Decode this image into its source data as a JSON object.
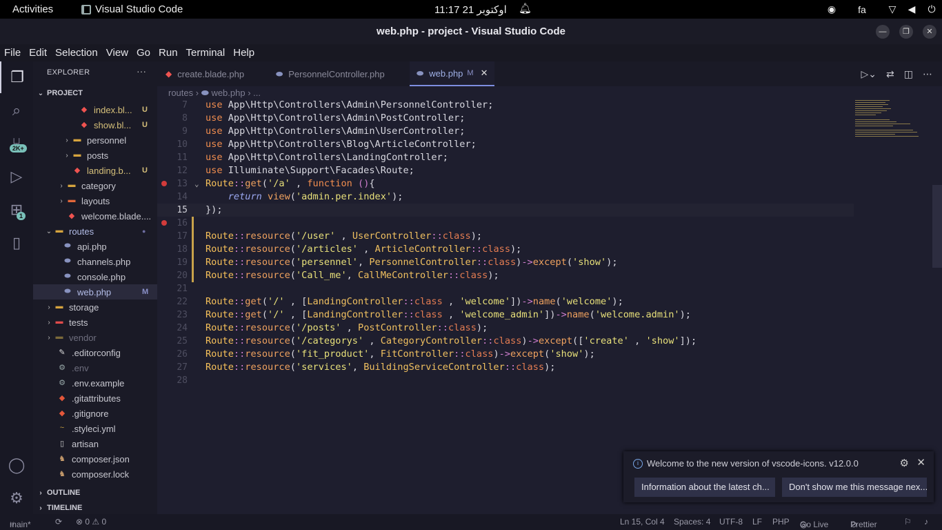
{
  "topbar": {
    "activities": "Activities",
    "app_name": "Visual Studio Code",
    "clock": "11:17  21 اوکتوبر",
    "lang": "fa"
  },
  "window": {
    "title": "web.php - project - Visual Studio Code"
  },
  "menu": [
    "File",
    "Edit",
    "Selection",
    "View",
    "Go",
    "Run",
    "Terminal",
    "Help"
  ],
  "activity_bar": {
    "source_control_badge": "2K+",
    "extensions_badge": "1"
  },
  "explorer": {
    "header": "EXPLORER",
    "more": "···",
    "project": "PROJECT",
    "items": [
      {
        "name": "index.bl...",
        "status": "U"
      },
      {
        "name": "show.bl...",
        "status": "U"
      },
      {
        "name": "personnel",
        "status": ""
      },
      {
        "name": "posts",
        "status": ""
      },
      {
        "name": "landing.b...",
        "status": "U"
      },
      {
        "name": "category",
        "status": ""
      },
      {
        "name": "layouts",
        "status": ""
      },
      {
        "name": "welcome.blade....",
        "status": ""
      },
      {
        "name": "routes",
        "status": "●"
      },
      {
        "name": "api.php",
        "status": ""
      },
      {
        "name": "channels.php",
        "status": ""
      },
      {
        "name": "console.php",
        "status": ""
      },
      {
        "name": "web.php",
        "status": "M"
      },
      {
        "name": "storage",
        "status": ""
      },
      {
        "name": "tests",
        "status": ""
      },
      {
        "name": "vendor",
        "status": ""
      },
      {
        "name": ".editorconfig",
        "status": ""
      },
      {
        "name": ".env",
        "status": ""
      },
      {
        "name": ".env.example",
        "status": ""
      },
      {
        "name": ".gitattributes",
        "status": ""
      },
      {
        "name": ".gitignore",
        "status": ""
      },
      {
        "name": ".styleci.yml",
        "status": ""
      },
      {
        "name": "artisan",
        "status": ""
      },
      {
        "name": "composer.json",
        "status": ""
      },
      {
        "name": "composer.lock",
        "status": ""
      }
    ],
    "outline": "OUTLINE",
    "timeline": "TIMELINE"
  },
  "tabs": [
    {
      "label": "create.blade.php"
    },
    {
      "label": "PersonnelController.php"
    },
    {
      "label": "web.php",
      "modified": "M"
    }
  ],
  "breadcrumb": {
    "part1": "routes",
    "part2": "web.php",
    "part3": "..."
  },
  "code": {
    "lines": [
      {
        "n": "7"
      },
      {
        "n": "8"
      },
      {
        "n": "9"
      },
      {
        "n": "10"
      },
      {
        "n": "11"
      },
      {
        "n": "12"
      },
      {
        "n": "13"
      },
      {
        "n": "14"
      },
      {
        "n": "15"
      },
      {
        "n": "16"
      },
      {
        "n": "17"
      },
      {
        "n": "18"
      },
      {
        "n": "19"
      },
      {
        "n": "20"
      },
      {
        "n": "21"
      },
      {
        "n": "22"
      },
      {
        "n": "23"
      },
      {
        "n": "24"
      },
      {
        "n": "25"
      },
      {
        "n": "26"
      },
      {
        "n": "27"
      },
      {
        "n": "28"
      }
    ]
  },
  "notification": {
    "message": "Welcome to the new version of vscode-icons. v12.0.0",
    "btn_info": "Information about the latest ch...",
    "btn_dismiss": "Don't show me this message nex..."
  },
  "status": {
    "branch": "main*",
    "problems": "⊗ 0 ⚠ 0",
    "position": "Ln 15, Col 4",
    "spaces": "Spaces: 4",
    "encoding": "UTF-8",
    "eol": "LF",
    "language": "PHP",
    "golive": "Go Live",
    "prettier": "Prettier"
  }
}
